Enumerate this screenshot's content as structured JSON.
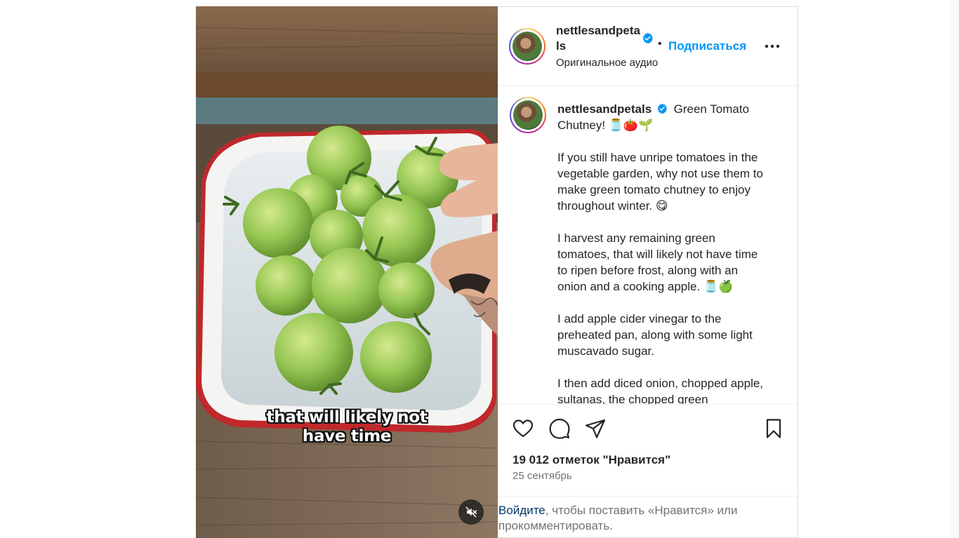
{
  "media": {
    "caption_line1": "that will likely not",
    "caption_line2": "have time",
    "mute_icon": "speaker-muted-icon"
  },
  "header": {
    "username": "nettlesandpetals",
    "verified_icon": "verified-badge-icon",
    "separator": "•",
    "follow_label": "Подписаться",
    "more_icon": "more-options-icon",
    "audio_label": "Оригинальное аудио"
  },
  "post": {
    "username": "nettlesandpetals",
    "title_text": "Green Tomato Chutney! 🫙🍅🌱",
    "paragraphs": [
      "If you still have unripe tomatoes in the vegetable garden, why not use them to make green tomato chutney to enjoy throughout winter. 😋",
      "I harvest any remaining green tomatoes, that will likely not have time to ripen before frost, along with an onion and a cooking apple. 🫙🍏",
      "I add apple cider vinegar to the preheated pan, along with some light muscavado sugar.",
      "I then add diced onion, chopped apple, sultanas, the chopped green"
    ]
  },
  "actions": {
    "like_icon": "heart-icon",
    "comment_icon": "comment-icon",
    "share_icon": "share-icon",
    "save_icon": "bookmark-icon",
    "likes_text": "19 012 отметок \"Нравится\"",
    "date_text": "25 сентябрь"
  },
  "login": {
    "link_text": "Войдите",
    "rest_text": ", чтобы поставить «Нравится» или прокомментировать."
  },
  "colors": {
    "accent": "#0095f6",
    "text": "#262626",
    "muted": "#737373",
    "border": "#dbdbdb"
  }
}
